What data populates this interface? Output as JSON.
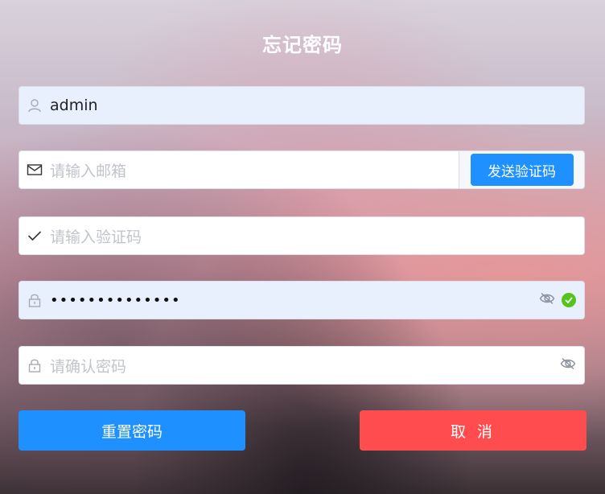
{
  "form": {
    "title": "忘记密码",
    "username": {
      "value": "admin",
      "icon": "user-icon"
    },
    "email": {
      "placeholder": "请输入邮箱",
      "icon": "mail-icon",
      "send_label": "发送验证码"
    },
    "code": {
      "placeholder": "请输入验证码",
      "icon": "check-icon"
    },
    "password": {
      "masked_value": "••••••••••••••",
      "icon": "lock-icon",
      "status": "valid"
    },
    "confirm_password": {
      "placeholder": "请确认密码",
      "icon": "lock-icon"
    },
    "reset_label": "重置密码",
    "cancel_label": "取 消"
  },
  "colors": {
    "primary": "#1e90ff",
    "danger": "#ff4d4f",
    "success": "#52c41a",
    "autofill": "#e8f0fe"
  }
}
